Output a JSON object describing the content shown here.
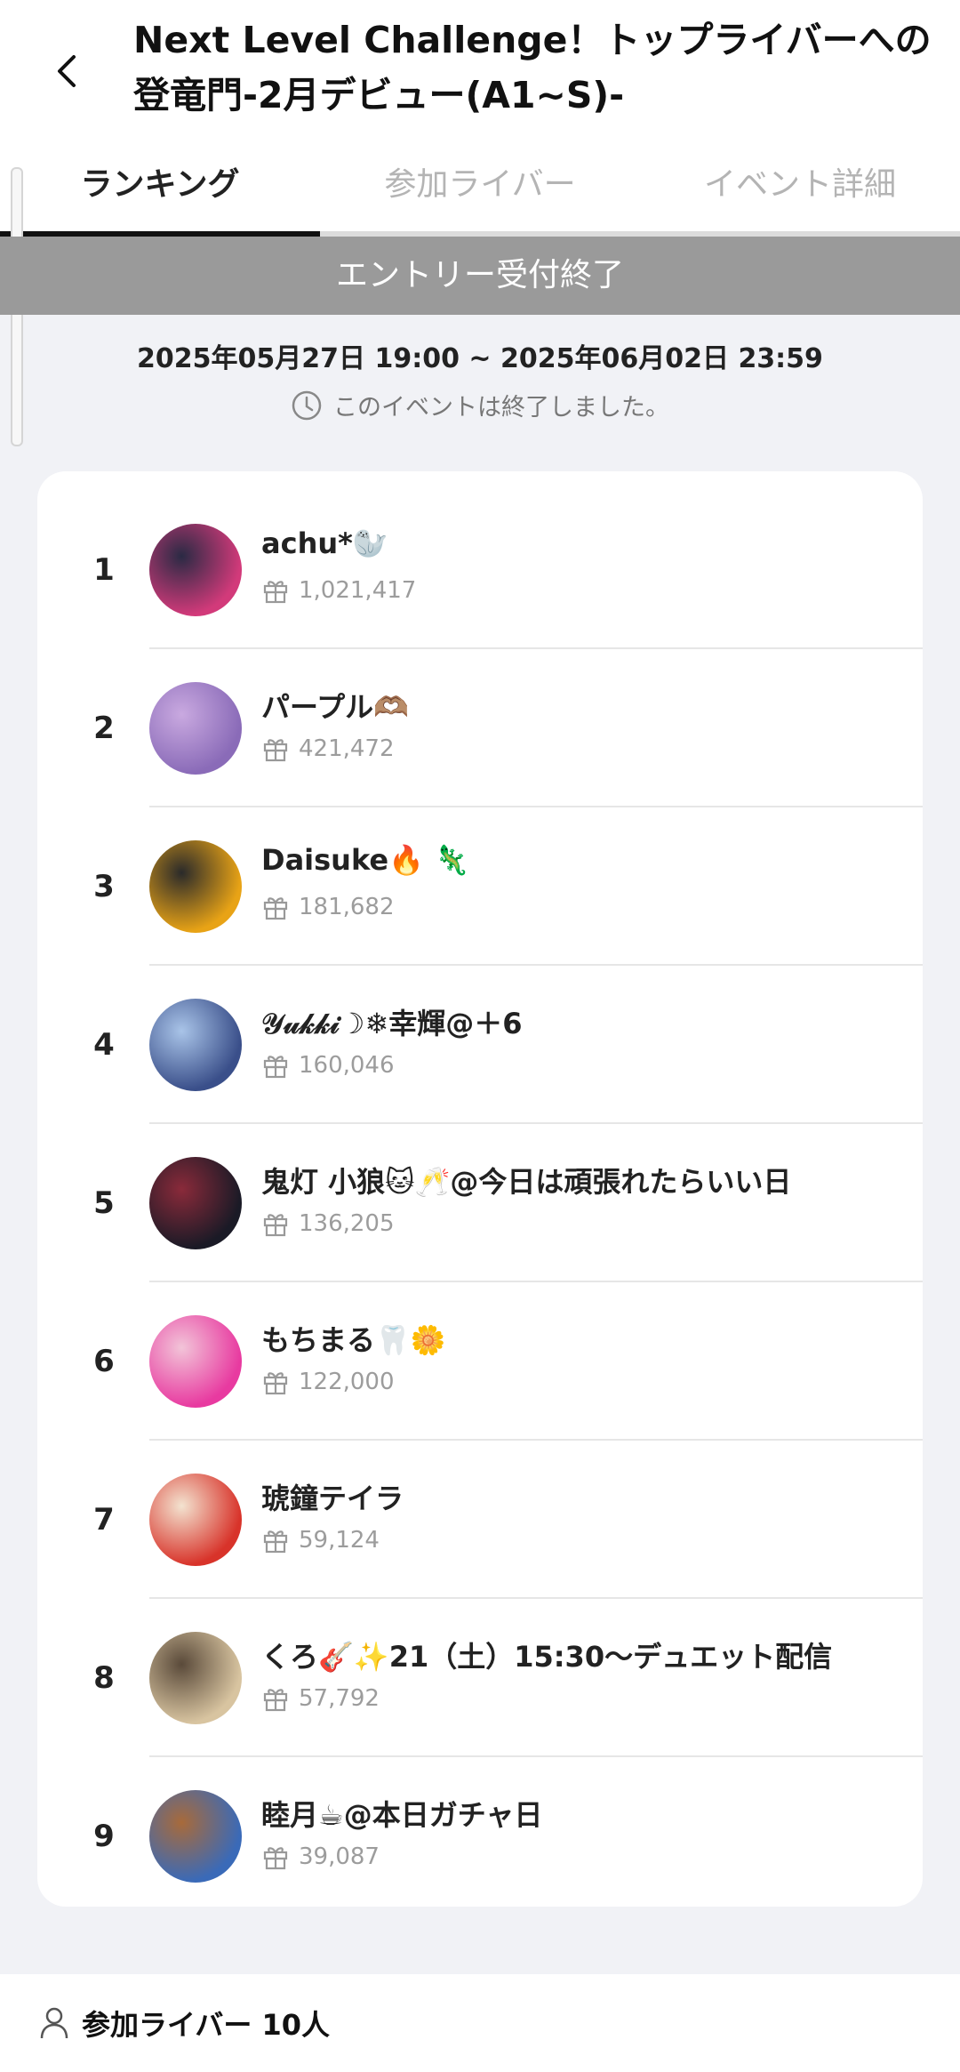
{
  "header": {
    "title": "Next Level Challenge！トップライバーへの登竜門-2月デビュー(A1~S)-"
  },
  "tabs": [
    {
      "label": "ランキング",
      "active": true
    },
    {
      "label": "参加ライバー",
      "active": false
    },
    {
      "label": "イベント詳細",
      "active": false
    }
  ],
  "banner": {
    "text": "エントリー受付終了"
  },
  "period": {
    "text": "2025年05月27日 19:00 ~ 2025年06月02日 23:59"
  },
  "status": {
    "text": "このイベントは終了しました。",
    "icon": "clock-icon"
  },
  "ranking": [
    {
      "rank": "1",
      "name": "achu*🦭",
      "score": "1,021,417",
      "avatar_bg": "#d23a7a",
      "avatar_bg2": "#2a2a44"
    },
    {
      "rank": "2",
      "name": "パープル🫶🏽",
      "score": "421,472",
      "avatar_bg": "#8a6bb8",
      "avatar_bg2": "#c9a9e0"
    },
    {
      "rank": "3",
      "name": "Daisuke🔥 🦎",
      "score": "181,682",
      "avatar_bg": "#e8a316",
      "avatar_bg2": "#2a2a2a"
    },
    {
      "rank": "4",
      "name": "𝒴𝓊𝓀𝓀𝒾☽❄幸輝@＋6",
      "score": "160,046",
      "avatar_bg": "#3a4f8a",
      "avatar_bg2": "#a9c4e8"
    },
    {
      "rank": "5",
      "name": "鬼灯 小狼🐱🥂@今日は頑張れたらいい日",
      "score": "136,205",
      "avatar_bg": "#1a1a26",
      "avatar_bg2": "#8a2a3a"
    },
    {
      "rank": "6",
      "name": "もちまる🦷🌼",
      "score": "122,000",
      "avatar_bg": "#e83aa0",
      "avatar_bg2": "#f2c4d8"
    },
    {
      "rank": "7",
      "name": "琥鐘テイラ",
      "score": "59,124",
      "avatar_bg": "#d8332a",
      "avatar_bg2": "#f3e3d0"
    },
    {
      "rank": "8",
      "name": "くろ🎸✨21（土）15:30〜デュエット配信",
      "score": "57,792",
      "avatar_bg": "#d8c4a0",
      "avatar_bg2": "#5a4a3a"
    },
    {
      "rank": "9",
      "name": "睦月☕@本日ガチャ日",
      "score": "39,087",
      "avatar_bg": "#3a6ab8",
      "avatar_bg2": "#a86a3a"
    }
  ],
  "footer": {
    "label": "参加ライバー 10人",
    "icon": "person-icon"
  }
}
